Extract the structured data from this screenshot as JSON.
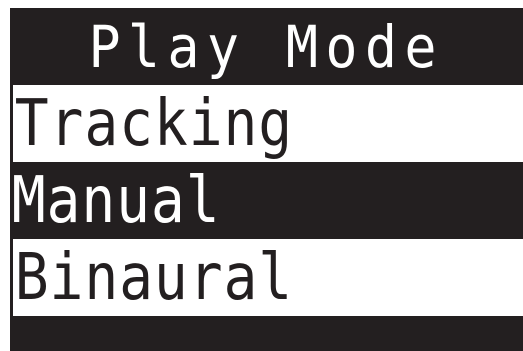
{
  "screen": {
    "title": "Play Mode"
  },
  "menu": {
    "items": [
      {
        "label": "Tracking",
        "selected": false
      },
      {
        "label": "Manual",
        "selected": true
      },
      {
        "label": "Binaural",
        "selected": false
      }
    ]
  },
  "colors": {
    "background": "#231f20",
    "foreground": "#ffffff"
  }
}
